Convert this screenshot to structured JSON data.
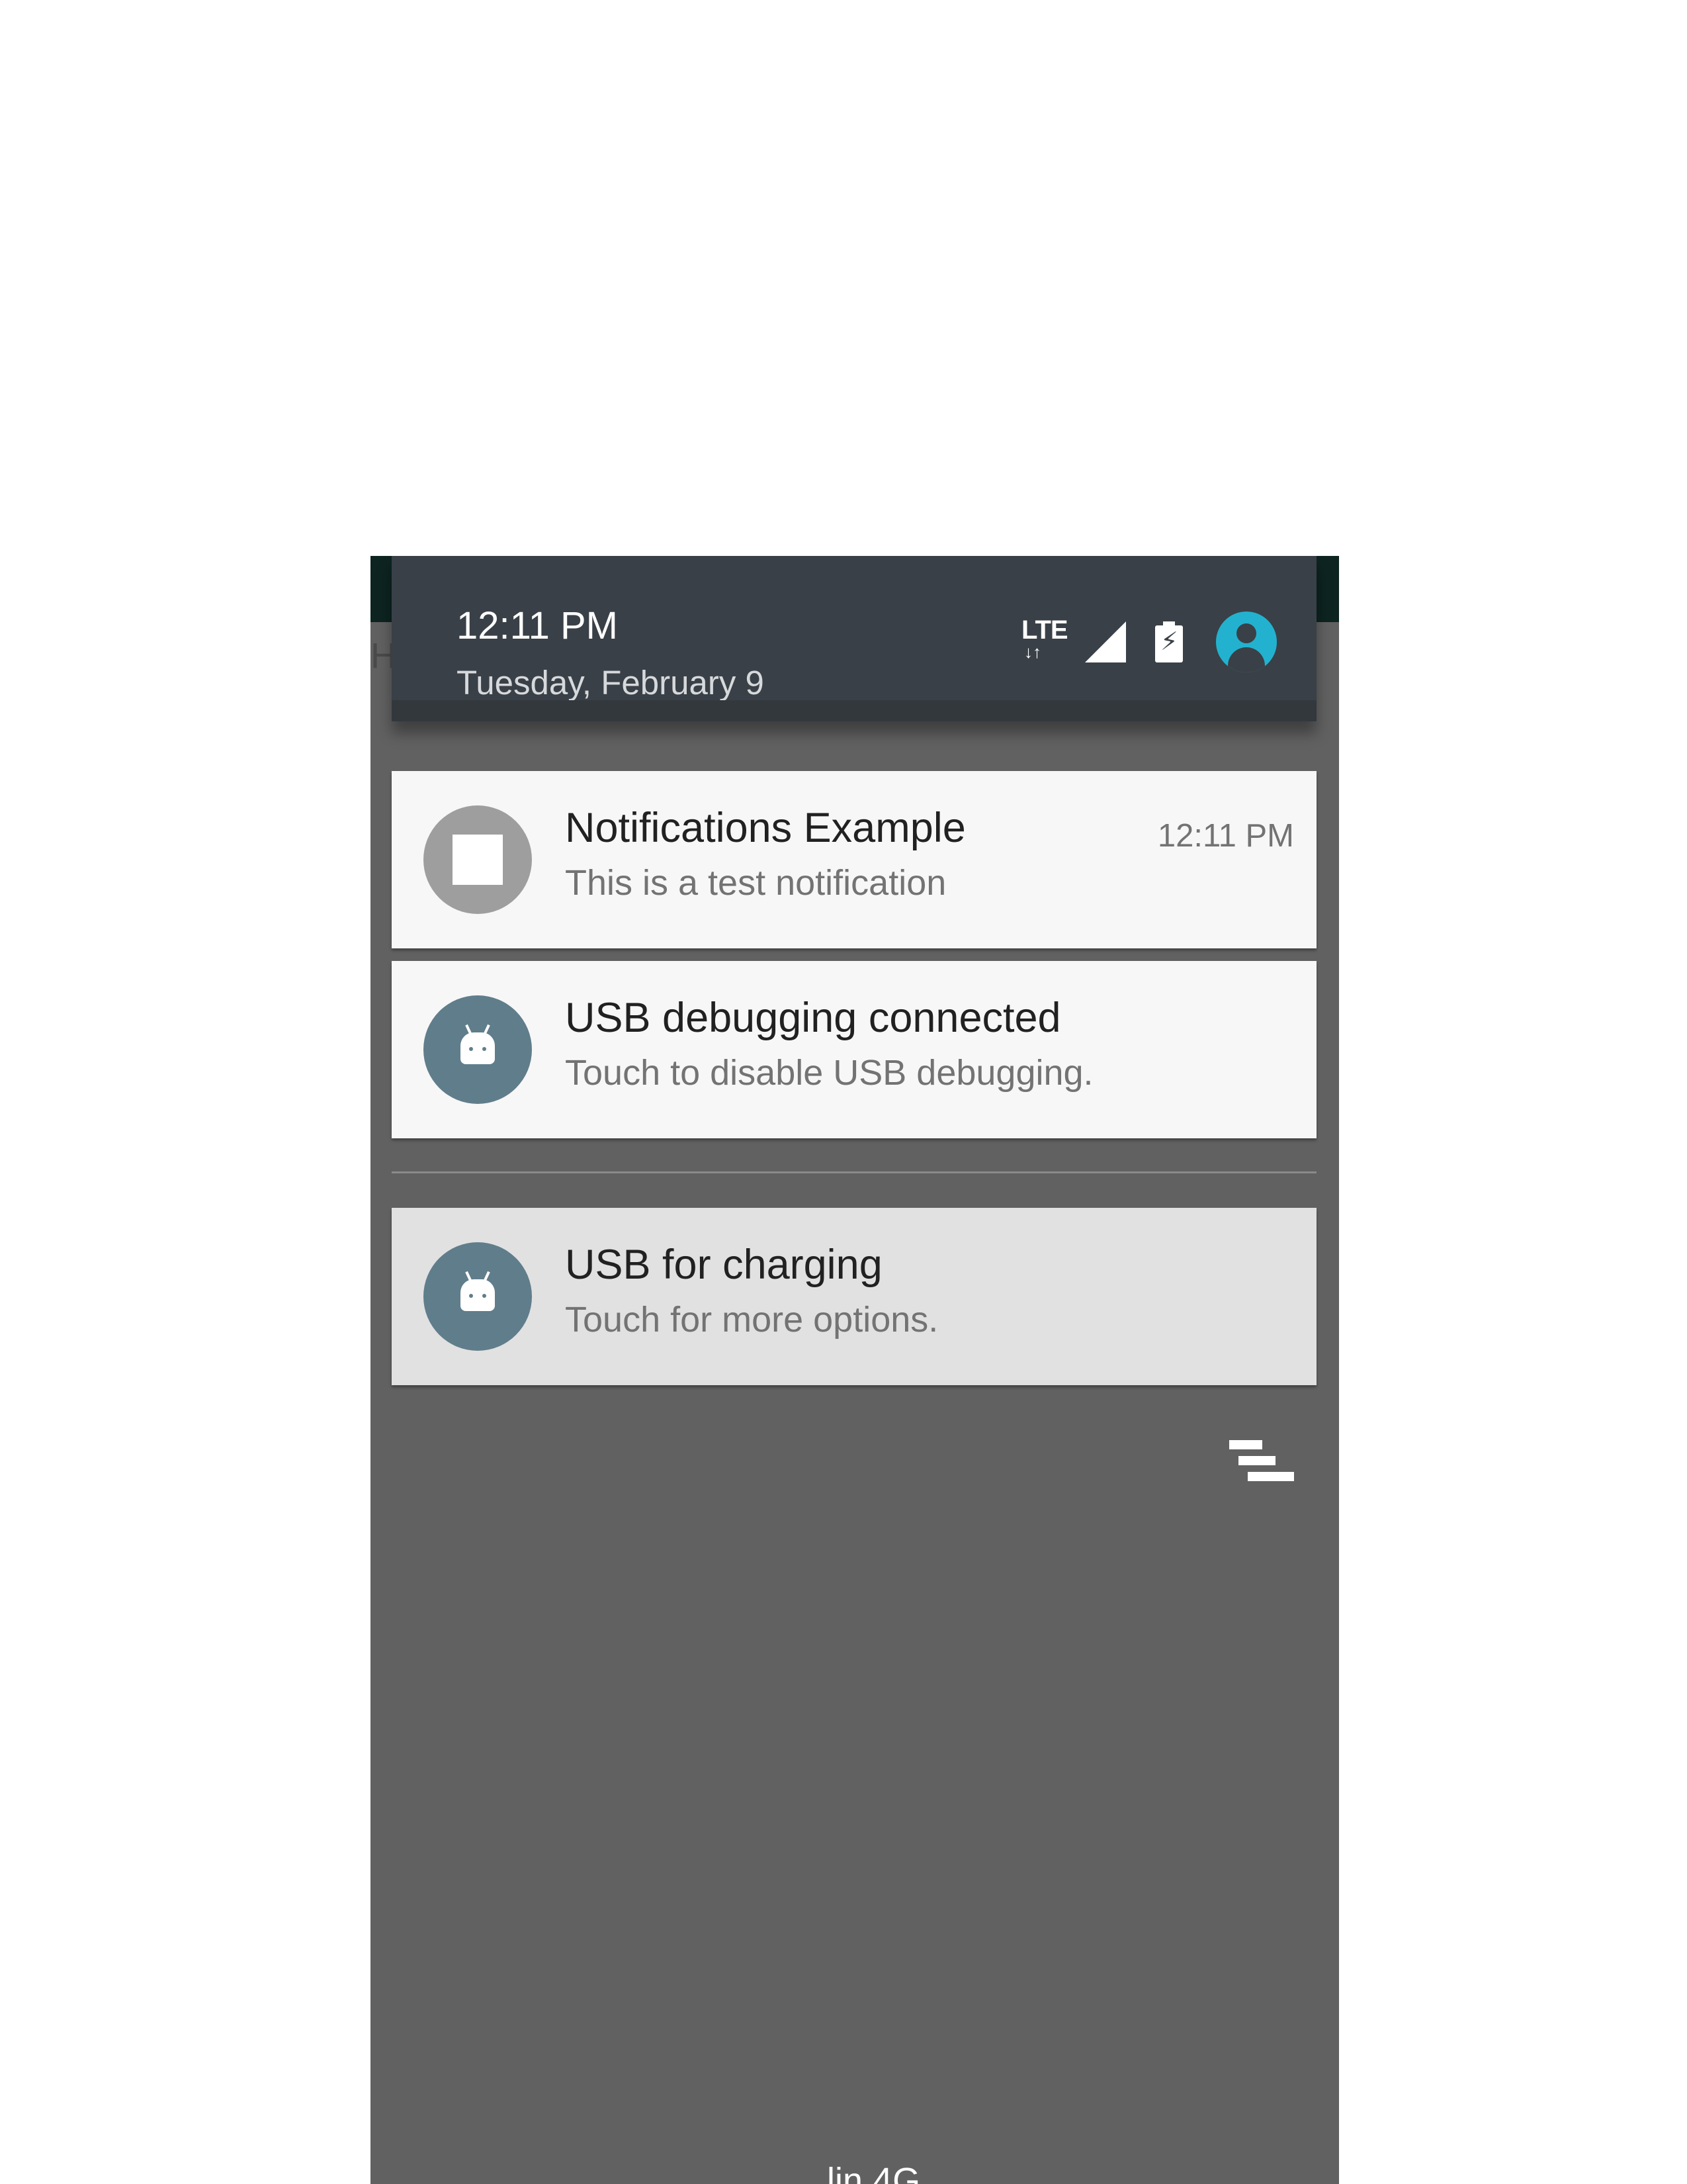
{
  "background_app": {
    "partial_letter": "H",
    "bottom_partial_text": "..lin 4G"
  },
  "status_header": {
    "time": "12:11 PM",
    "date": "Tuesday, February 9",
    "network_label": "LTE",
    "network_arrows": "↓↑",
    "icons": [
      "lte-icon",
      "signal-icon",
      "battery-charging-icon",
      "account-icon"
    ],
    "accent_color": "#22b2cf"
  },
  "notifications": [
    {
      "title": "Notifications Example",
      "text": "This is a test notification",
      "time": "12:11 PM",
      "icon": "square-icon"
    },
    {
      "title": "USB debugging connected",
      "text": "Touch to disable USB debugging.",
      "icon": "android-icon"
    },
    {
      "title": "USB for charging",
      "text": "Touch for more options.",
      "icon": "android-icon"
    }
  ],
  "dismiss_all_icon": "clear-all-icon"
}
